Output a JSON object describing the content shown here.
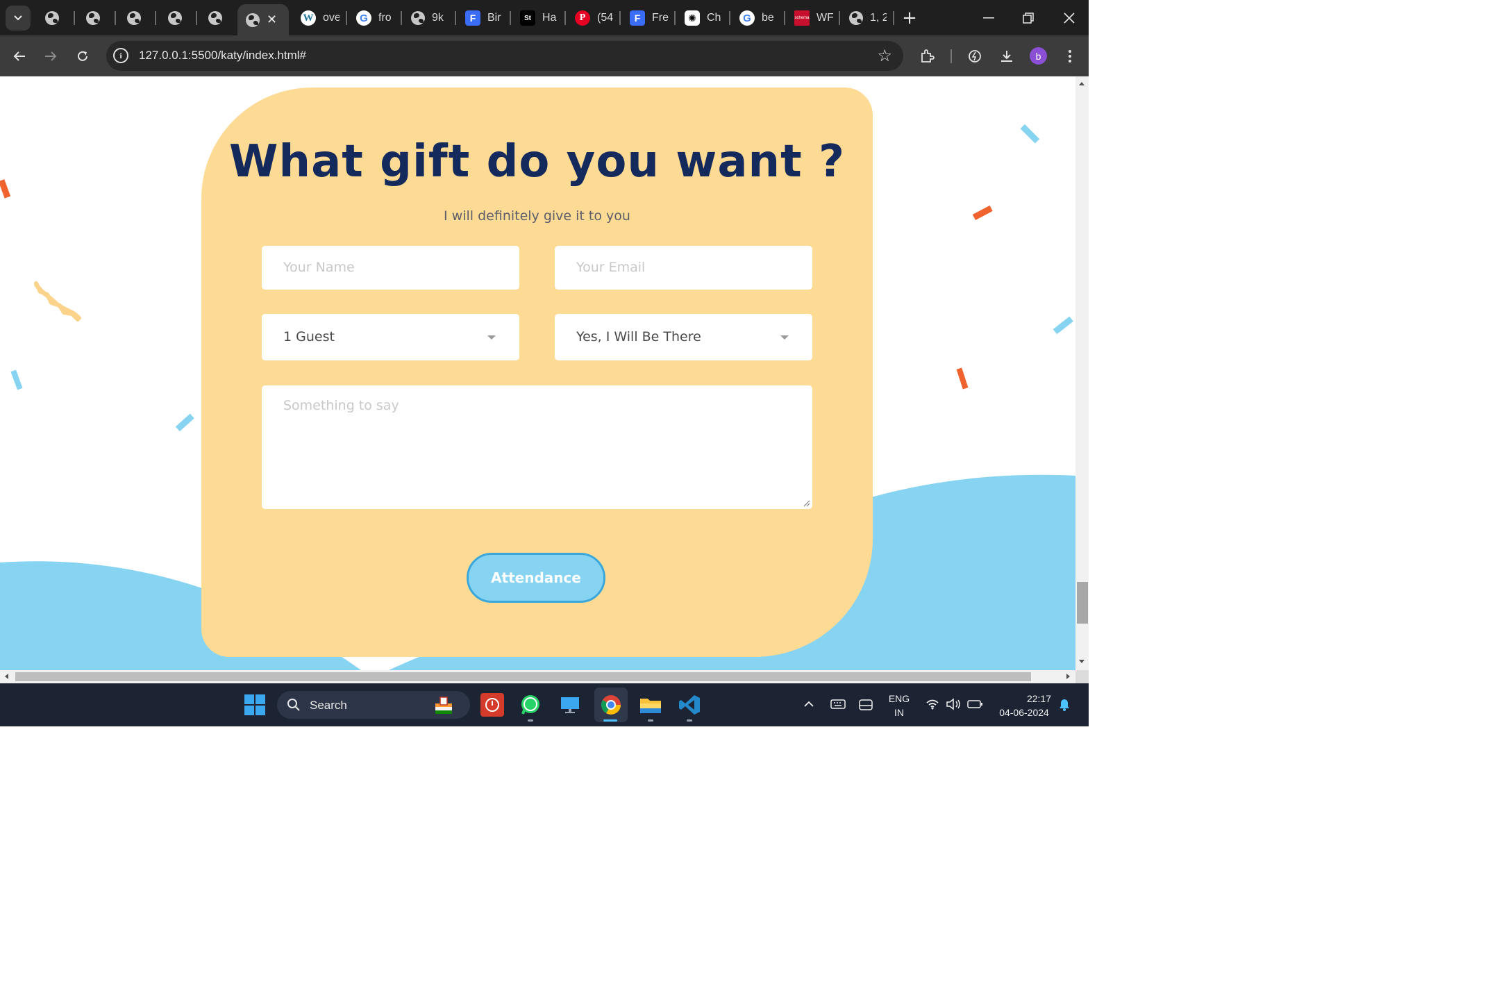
{
  "browser": {
    "tabs": [
      {
        "icon": "globe-icon",
        "title": ""
      },
      {
        "icon": "globe-icon",
        "title": ""
      },
      {
        "icon": "globe-icon",
        "title": ""
      },
      {
        "icon": "globe-icon",
        "title": ""
      },
      {
        "icon": "globe-icon",
        "title": ""
      },
      {
        "icon": "globe-icon",
        "title": "",
        "active": true
      },
      {
        "icon": "wordpress-icon",
        "title": "ove"
      },
      {
        "icon": "google-icon",
        "title": "fro"
      },
      {
        "icon": "globe-icon",
        "title": "9k"
      },
      {
        "icon": "f-logo-icon",
        "title": "Bir"
      },
      {
        "icon": "st-logo-icon",
        "title": "Ha"
      },
      {
        "icon": "pinterest-icon",
        "title": "(54"
      },
      {
        "icon": "f-logo-icon",
        "title": "Fre"
      },
      {
        "icon": "chatgpt-icon",
        "title": "Ch"
      },
      {
        "icon": "google-icon",
        "title": "be"
      },
      {
        "icon": "schema-icon",
        "title": "WF"
      },
      {
        "icon": "globe-icon",
        "title": "1, 2"
      }
    ],
    "url": "127.0.0.1:5500/katy/index.html#",
    "profile_initial": "b"
  },
  "page": {
    "title": "What gift do you want ?",
    "subtitle": "I will definitely give it to you",
    "name_placeholder": "Your Name",
    "email_placeholder": "Your Email",
    "guests_selected": "1 Guest",
    "attendance_selected": "Yes, I Will Be There",
    "message_placeholder": "Something to say",
    "submit_label": "Attendance"
  },
  "colors": {
    "card": "#fedb95",
    "title": "#152a5c",
    "wave": "#87d3f2",
    "button_border": "#3ba7db",
    "confetti_orange": "#f0622e",
    "confetti_blue": "#87d3f2",
    "confetti_yellow": "#fbd38a"
  },
  "taskbar": {
    "search_label": "Search",
    "language_line1": "ENG",
    "language_line2": "IN",
    "time": "22:17",
    "date": "04-06-2024"
  }
}
